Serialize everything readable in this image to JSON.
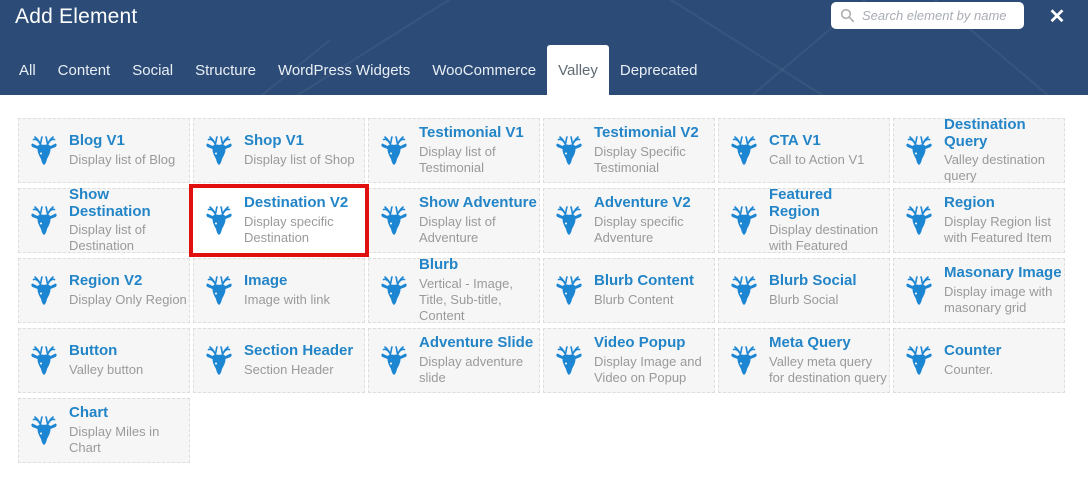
{
  "header": {
    "title": "Add Element",
    "search_placeholder": "Search element by name",
    "close_glyph": "✕"
  },
  "tabs": [
    {
      "label": "All",
      "active": false
    },
    {
      "label": "Content",
      "active": false
    },
    {
      "label": "Social",
      "active": false
    },
    {
      "label": "Structure",
      "active": false
    },
    {
      "label": "WordPress Widgets",
      "active": false
    },
    {
      "label": "WooCommerce",
      "active": false
    },
    {
      "label": "Valley",
      "active": true
    },
    {
      "label": "Deprecated",
      "active": false
    }
  ],
  "elements": [
    {
      "title": "Blog V1",
      "desc": "Display list of Blog",
      "highlighted": false
    },
    {
      "title": "Shop V1",
      "desc": "Display list of Shop",
      "highlighted": false
    },
    {
      "title": "Testimonial V1",
      "desc": "Display list of Testimonial",
      "highlighted": false
    },
    {
      "title": "Testimonial V2",
      "desc": "Display Specific Testimonial",
      "highlighted": false
    },
    {
      "title": "CTA V1",
      "desc": "Call to Action V1",
      "highlighted": false
    },
    {
      "title": "Destination Query",
      "desc": "Valley destination query",
      "highlighted": false
    },
    {
      "title": "Show Destination",
      "desc": "Display list of Destination",
      "highlighted": false
    },
    {
      "title": "Destination V2",
      "desc": "Display specific Destination",
      "highlighted": true
    },
    {
      "title": "Show Adventure",
      "desc": "Display list of Adventure",
      "highlighted": false
    },
    {
      "title": "Adventure V2",
      "desc": "Display specific Adventure",
      "highlighted": false
    },
    {
      "title": "Featured Region",
      "desc": "Display destination with Featured",
      "highlighted": false
    },
    {
      "title": "Region",
      "desc": "Display Region list with Featured Item",
      "highlighted": false
    },
    {
      "title": "Region V2",
      "desc": "Display Only Region",
      "highlighted": false
    },
    {
      "title": "Image",
      "desc": "Image with link",
      "highlighted": false
    },
    {
      "title": "Blurb",
      "desc": "Vertical - Image, Title, Sub-title, Content",
      "highlighted": false
    },
    {
      "title": "Blurb Content",
      "desc": "Blurb Content",
      "highlighted": false
    },
    {
      "title": "Blurb Social",
      "desc": "Blurb Social",
      "highlighted": false
    },
    {
      "title": "Masonary Image",
      "desc": "Display image with masonary grid",
      "highlighted": false
    },
    {
      "title": "Button",
      "desc": "Valley button",
      "highlighted": false
    },
    {
      "title": "Section Header",
      "desc": "Section Header",
      "highlighted": false
    },
    {
      "title": "Adventure Slide",
      "desc": "Display adventure slide",
      "highlighted": false
    },
    {
      "title": "Video Popup",
      "desc": "Display Image and Video on Popup",
      "highlighted": false
    },
    {
      "title": "Meta Query",
      "desc": "Valley meta query for destination query",
      "highlighted": false
    },
    {
      "title": "Counter",
      "desc": "Counter.",
      "highlighted": false
    },
    {
      "title": "Chart",
      "desc": "Display Miles in Chart",
      "highlighted": false
    }
  ],
  "colors": {
    "header_bg": "#2c4c77",
    "accent_blue": "#2385c7",
    "icon_blue": "#1d86d2",
    "highlight_red": "#e20f0f",
    "card_bg": "#f6f6f6",
    "desc_gray": "#9a9a9a"
  }
}
